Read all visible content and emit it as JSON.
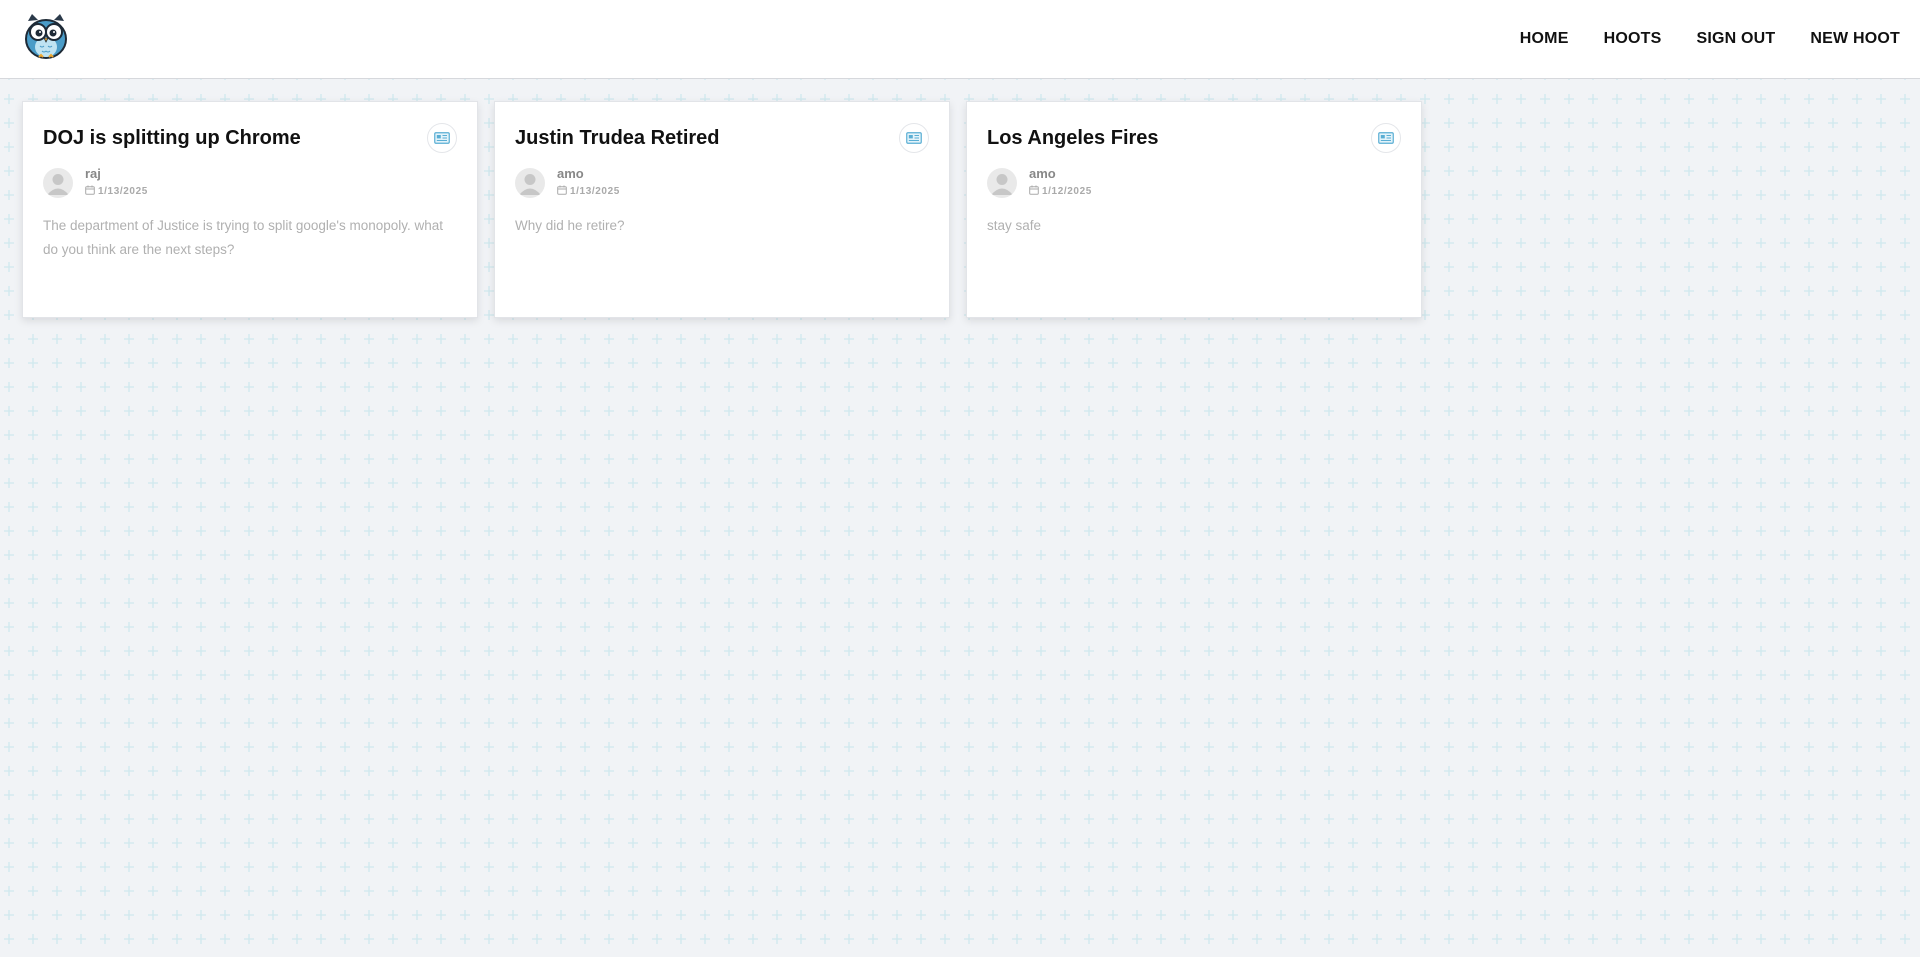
{
  "header": {
    "logo": "owl-logo",
    "nav": {
      "home": "HOME",
      "hoots": "HOOTS",
      "sign_out": "SIGN OUT",
      "new_hoot": "NEW HOOT"
    }
  },
  "colors": {
    "background": "#f1f3f6",
    "pattern": "#cfe8ee",
    "card": "#ffffff",
    "title": "#111111",
    "muted_text": "#b0b0b0",
    "icon_accent": "#5aaed4"
  },
  "hoots": [
    {
      "title": "DOJ is splitting up Chrome",
      "author": "raj",
      "date": "1/13/2025",
      "text": "The department of Justice is trying to split google's monopoly. what do you think are the next steps?",
      "icon": "news-icon"
    },
    {
      "title": "Justin Trudea Retired",
      "author": "amo",
      "date": "1/13/2025",
      "text": "Why did he retire?",
      "icon": "news-icon"
    },
    {
      "title": "Los Angeles Fires",
      "author": "amo",
      "date": "1/12/2025",
      "text": "stay safe",
      "icon": "news-icon"
    }
  ]
}
